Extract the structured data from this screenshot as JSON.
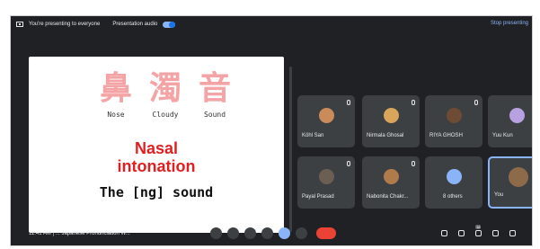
{
  "topbar": {
    "presenting_text": "You're presenting to everyone",
    "audio_label": "Presentation audio",
    "stop_label": "Stop presenting"
  },
  "slide": {
    "kanji": [
      {
        "char": "鼻",
        "label": "Nose"
      },
      {
        "char": "濁",
        "label": "Cloudy"
      },
      {
        "char": "音",
        "label": "Sound"
      }
    ],
    "title_line1": "Nasal",
    "title_line2": "intonation",
    "subtitle": "The [ng] sound"
  },
  "participants": [
    {
      "name": "Köhl San",
      "color": "#c98b5a"
    },
    {
      "name": "Nirmala Ghosal",
      "color": "#d8a55a"
    },
    {
      "name": "RIYA GHOSH",
      "color": "#6e4b34"
    },
    {
      "name": "Yuu Kun",
      "color": "#b7a1e0"
    },
    {
      "name": "Payal Prasad",
      "color": "#6b5e53"
    },
    {
      "name": "Nabonita Chakr...",
      "color": "#b07b4b"
    },
    {
      "name": "8 others",
      "color": "#8ab4f8"
    },
    {
      "name": "You",
      "color": "#8d6b4a"
    }
  ],
  "bottom": {
    "time_text": "11:41 AM | ... Japanese Pronunciation W...",
    "participants_count": "16"
  }
}
